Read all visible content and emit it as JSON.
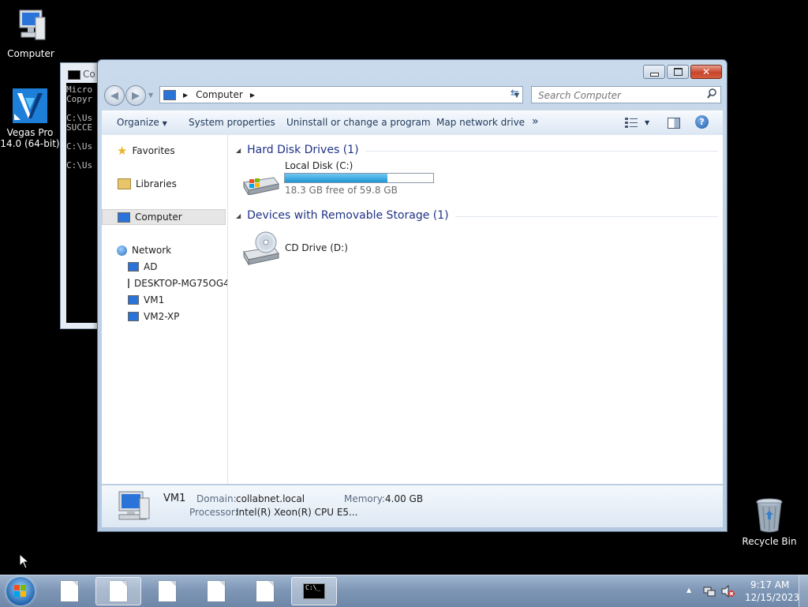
{
  "desktop": {
    "icons": [
      {
        "label": "Computer",
        "icon": "computer-icon"
      },
      {
        "label_line1": "Vegas Pro",
        "label_line2": "14.0 (64-bit)",
        "icon": "vegas-pro-icon"
      },
      {
        "label": "Recycle Bin",
        "icon": "recycle-bin-icon"
      }
    ]
  },
  "cmd_window": {
    "title": "Co",
    "lines": [
      "Micro",
      "Copyr",
      "",
      "C:\\Us",
      "SUCCE",
      "",
      "C:\\Us",
      "",
      "C:\\Us"
    ]
  },
  "explorer": {
    "address": {
      "crumb": "Computer"
    },
    "search": {
      "placeholder": "Search Computer"
    },
    "toolbar": {
      "organize": "Organize",
      "system_properties": "System properties",
      "uninstall": "Uninstall or change a program",
      "map_drive": "Map network drive",
      "more": "»"
    },
    "nav": {
      "favorites": "Favorites",
      "libraries": "Libraries",
      "computer": "Computer",
      "network": "Network",
      "network_items": [
        "AD",
        "DESKTOP-MG75OG4",
        "VM1",
        "VM2-XP"
      ]
    },
    "groups": {
      "hard_disk": "Hard Disk Drives (1)",
      "removable": "Devices with Removable Storage (1)"
    },
    "drives": {
      "c": {
        "name": "Local Disk (C:)",
        "free_text": "18.3 GB free of 59.8 GB",
        "used_fraction": 0.694
      },
      "d": {
        "name": "CD Drive (D:)"
      }
    },
    "details": {
      "name": "VM1",
      "domain_label": "Domain:",
      "domain": "collabnet.local",
      "memory_label": "Memory:",
      "memory": "4.00 GB",
      "processor_label": "Processor:",
      "processor": "Intel(R) Xeon(R) CPU E5..."
    }
  },
  "taskbar": {
    "time": "9:17 AM",
    "date": "12/15/2023",
    "cmd_icon_text": "C:\\_"
  },
  "colors": {
    "accent_blue": "#1e3287",
    "progress_fill": "#26a0da",
    "taskbar": "#7f97b6"
  }
}
